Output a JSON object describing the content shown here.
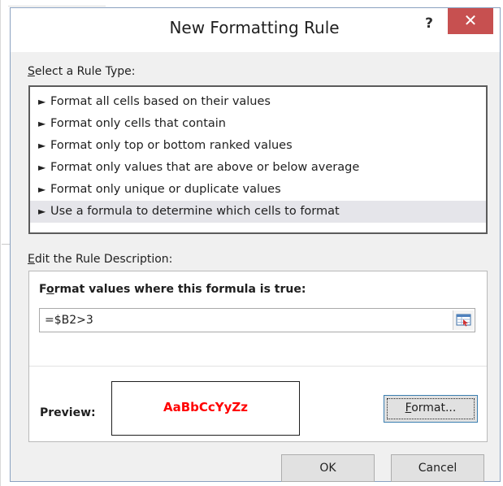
{
  "dialog": {
    "title": "New Formatting Rule",
    "help_label": "?",
    "close_label": "✕"
  },
  "select_rule_type": {
    "label_accel": "S",
    "label_rest": "elect a Rule Type:",
    "items": [
      {
        "label": "Format all cells based on their values"
      },
      {
        "label": "Format only cells that contain"
      },
      {
        "label": "Format only top or bottom ranked values"
      },
      {
        "label": "Format only values that are above or below average"
      },
      {
        "label": "Format only unique or duplicate values"
      },
      {
        "label": "Use a formula to determine which cells to format"
      }
    ],
    "selected_index": 5,
    "arrow_glyph": "►"
  },
  "edit_rule": {
    "label_accel": "E",
    "label_rest": "dit the Rule Description:",
    "formula_label_pre": "F",
    "formula_label_accel": "o",
    "formula_label_post": "rmat values where this formula is true:",
    "formula_value": "=$B2>3",
    "preview_label": "Preview:",
    "preview_text": "AaBbCcYyZz",
    "preview_color": "#ff0000",
    "format_button_accel": "F",
    "format_button_rest": "ormat..."
  },
  "buttons": {
    "ok": "OK",
    "cancel": "Cancel"
  },
  "colors": {
    "close_button": "#c75050",
    "selected_row": "#e5e5ea",
    "focus_border": "#3c7fb1"
  }
}
